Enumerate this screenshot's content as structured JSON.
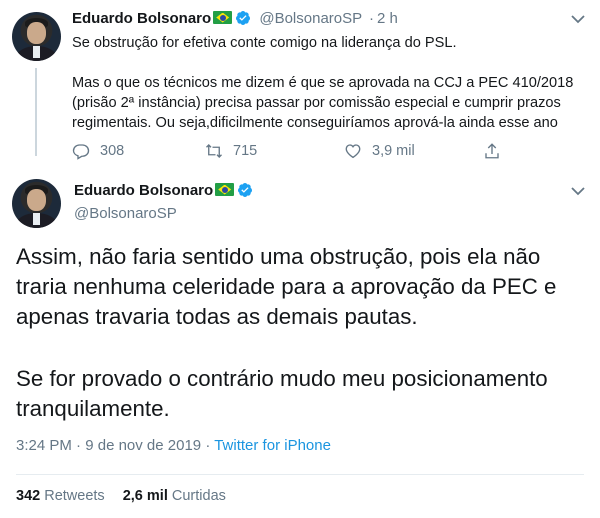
{
  "tweet1": {
    "name": "Eduardo Bolsonaro",
    "handle": "@BolsonaroSP",
    "separator": "·",
    "time": "2 h",
    "lines": [
      "Se obstrução for efetiva conte comigo na liderança do PSL.",
      "Mas o que os técnicos me dizem é que se aprovada na CCJ a PEC 410/2018",
      "(prisão 2ª instância) precisa passar por comissão especial e cumprir prazos",
      "regimentais. Ou seja,dificilmente conseguiríamos aprová-la ainda esse ano"
    ],
    "actions": {
      "replies": "308",
      "retweets": "715",
      "likes": "3,9 mil"
    }
  },
  "tweet2": {
    "name": "Eduardo Bolsonaro",
    "handle": "@BolsonaroSP",
    "lines": [
      "Assim, não faria sentido uma obstrução, pois ela não",
      "traria nenhuma celeridade para a aprovação da PEC e",
      "apenas travaria todas as demais pautas.",
      "Se for provado o contrário mudo meu posicionamento",
      "tranquilamente."
    ],
    "meta": {
      "time": "3:24 PM",
      "separator": " · ",
      "date": "9 de nov de 2019",
      "separator2": " · ",
      "source": "Twitter for iPhone"
    },
    "stats": {
      "retweets_count": "342",
      "retweets_label": "Retweets",
      "likes_count": "2,6 mil",
      "likes_label": "Curtidas"
    }
  },
  "colors": {
    "accent": "#1da1f2",
    "muted": "#657786",
    "text": "#14171a",
    "link": "#1b95e0"
  },
  "icons": [
    "reply-icon",
    "retweet-icon",
    "like-icon",
    "share-icon",
    "verified-icon",
    "chevron-down-icon",
    "brazil-flag-icon"
  ]
}
